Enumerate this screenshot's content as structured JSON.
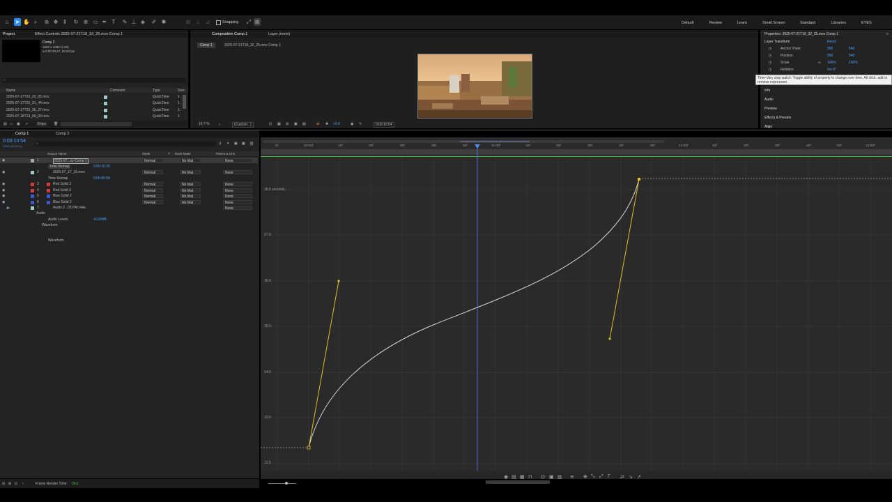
{
  "toolbar": {
    "snapping_label": "Snapping",
    "workspaces": [
      "Default",
      "Review",
      "Learn",
      "Small Screen",
      "Standard",
      "Libraries",
      "EYES"
    ]
  },
  "project": {
    "tab_project": "Project",
    "tab_effect_controls": "Effect Controls 2025-07-21T18_32_25.mov Comp 1",
    "comp_name": "Comp 2",
    "comp_info_1": "1920 x 1080 (1.00)",
    "comp_info_2": "Δ 0:00:30:47, 60.00 fps",
    "search_placeholder": "",
    "columns": {
      "name": "Name",
      "comment": "Comment",
      "type": "Type",
      "size": "Size"
    },
    "files": [
      {
        "name": "2025-07-17T23_22_05.mov",
        "type": "QuickTime",
        "size": "1."
      },
      {
        "name": "2025-07-17T23_31_44.mov",
        "type": "QuickTime",
        "size": "1."
      },
      {
        "name": "2025-07-17T23_35_27.mov",
        "type": "QuickTime",
        "size": "1."
      },
      {
        "name": "2025-07-18T13_00_03.mov",
        "type": "QuickTime",
        "size": "1."
      }
    ],
    "bpc": "8 bpc"
  },
  "composition": {
    "tab_label": "Composition Comp 1",
    "layer_tab": "Layer (none)",
    "breadcrumb_1": "Comp 1",
    "breadcrumb_2": "2025-07-21T18_32_25.mov Comp 1",
    "zoom": "16.7 %",
    "resolution": "(Custom...)",
    "exposure": "+0.0",
    "timecode": "0:00:10:54"
  },
  "properties": {
    "title": "Properties: 2025-07-21T18_32_25.mov Comp 1",
    "section": "Layer Transform",
    "reset": "Reset",
    "rows": [
      {
        "label": "Anchor Point",
        "v1": "960",
        "v2": "540"
      },
      {
        "label": "Position",
        "v1": "960",
        "v2": "540"
      },
      {
        "label": "Scale",
        "v1": "100%",
        "v2": "100%"
      },
      {
        "label": "Rotation",
        "v1": "0x+0°",
        "v2": ""
      }
    ],
    "tooltip": "Time-Vary stop watch: Toggle ability of property to change over time. Alt click: add or remove expression.",
    "panels": [
      "Info",
      "Audio",
      "Preview",
      "Effects & Presets",
      "Align"
    ]
  },
  "timeline": {
    "tabs": [
      "Comp 1",
      "Comp 2"
    ],
    "current_time": "0:00:10:54",
    "frames_info": "00654 (60.00 fps)",
    "columns": {
      "source_name": "Source Name",
      "mode": "Mode",
      "t": "T",
      "track_matte": "Track Matte",
      "parent": "Parent & Link"
    },
    "layers": [
      {
        "num": "1",
        "name": "2025-07...ov Comp 1",
        "color": "#a8a8a8",
        "mode": "Normal",
        "matte": "No Mat",
        "parent": "None"
      },
      {
        "num": "",
        "name": "Time Remap",
        "value": "0:00:15:25"
      },
      {
        "num": "2",
        "name": "2025-07_27_16.mov",
        "color": "#9ec9c6",
        "mode": "Normal",
        "matte": "No Mat",
        "parent": "None"
      },
      {
        "num": "",
        "name": "Time Remap",
        "value": "0:00:05:59"
      },
      {
        "num": "3",
        "name": "Red Solid 3",
        "color": "#d43a3a",
        "mode": "Normal",
        "matte": "No Mat",
        "parent": "None"
      },
      {
        "num": "4",
        "name": "Red Solid 3",
        "color": "#d43a3a",
        "mode": "Normal",
        "matte": "No Mat",
        "parent": "None"
      },
      {
        "num": "5",
        "name": "Blue Solid 2",
        "color": "#3a57d4",
        "mode": "Normal",
        "matte": "No Mat",
        "parent": "None"
      },
      {
        "num": "6",
        "name": "Blue Solid 2",
        "color": "#3a57d4",
        "mode": "Normal",
        "matte": "No Mat",
        "parent": "None"
      },
      {
        "num": "7",
        "name": "Audio 2...03 PM.m4a",
        "color": "#9ec9c6",
        "mode": "",
        "matte": "",
        "parent": "None"
      }
    ],
    "audio_label": "Audio",
    "audio_levels_label": "Audio Levels",
    "audio_levels_value": "+0.00dB",
    "waveform_label": "Waveform",
    "waveform_sub": "Waveform",
    "render_time_label": "Frame Render Time:",
    "render_time_value": "0ms"
  },
  "graph": {
    "ruler_ticks": [
      "5f",
      "10:00f",
      "10f",
      "20f",
      "30f",
      "40f",
      "50f",
      "11:00f",
      "10f",
      "20f",
      "30f",
      "40f",
      "50f",
      "12:00f",
      "10f",
      "20f",
      "30f",
      "40f",
      "50f",
      "13:00f"
    ],
    "y_labels": [
      "18.0 seconds",
      "17.0",
      "16.0",
      "15.0",
      "14.0",
      "13.0",
      "12.0"
    ]
  }
}
